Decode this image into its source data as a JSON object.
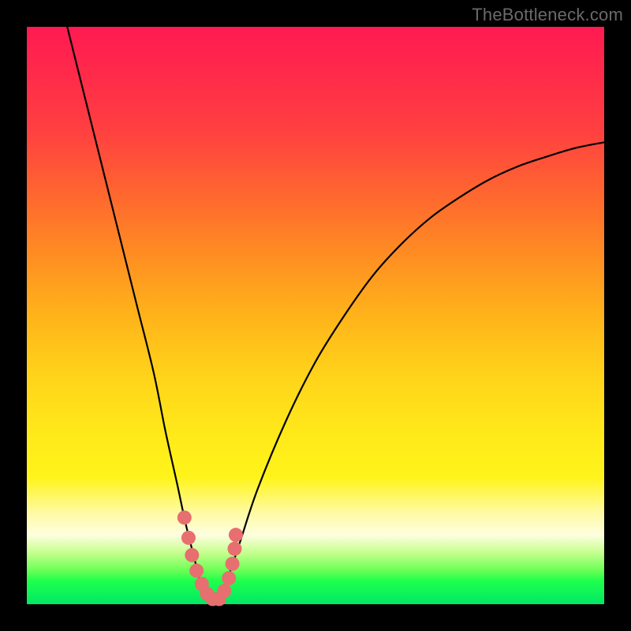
{
  "watermark": "TheBottleneck.com",
  "colors": {
    "frame": "#000000",
    "curve": "#000000",
    "marker": "#e76f6f",
    "gradient_top": "#ff1a52",
    "gradient_bottom": "#00e865"
  },
  "chart_data": {
    "type": "line",
    "title": "",
    "xlabel": "",
    "ylabel": "",
    "xlim": [
      0,
      100
    ],
    "ylim": [
      0,
      100
    ],
    "x": [
      7,
      10,
      13,
      16,
      19,
      22,
      24,
      26,
      27.5,
      29,
      30,
      31,
      32,
      33,
      34,
      35,
      37,
      40,
      45,
      50,
      55,
      60,
      65,
      70,
      75,
      80,
      85,
      90,
      95,
      100
    ],
    "values": [
      100,
      88,
      76,
      64,
      52,
      40,
      30,
      21,
      14,
      8,
      4,
      1.5,
      0.5,
      0.5,
      2,
      5,
      11,
      20,
      32,
      42,
      50,
      57,
      62.5,
      67,
      70.5,
      73.5,
      75.8,
      77.5,
      79,
      80
    ],
    "markers_x": [
      27.3,
      28.0,
      28.6,
      29.4,
      30.3,
      31.2,
      32.2,
      33.3,
      34.2,
      35.0,
      35.6,
      36.0,
      36.2
    ],
    "markers_y": [
      15.0,
      11.5,
      8.5,
      5.8,
      3.5,
      1.8,
      0.9,
      0.9,
      2.3,
      4.5,
      7.0,
      9.6,
      12.0
    ]
  }
}
